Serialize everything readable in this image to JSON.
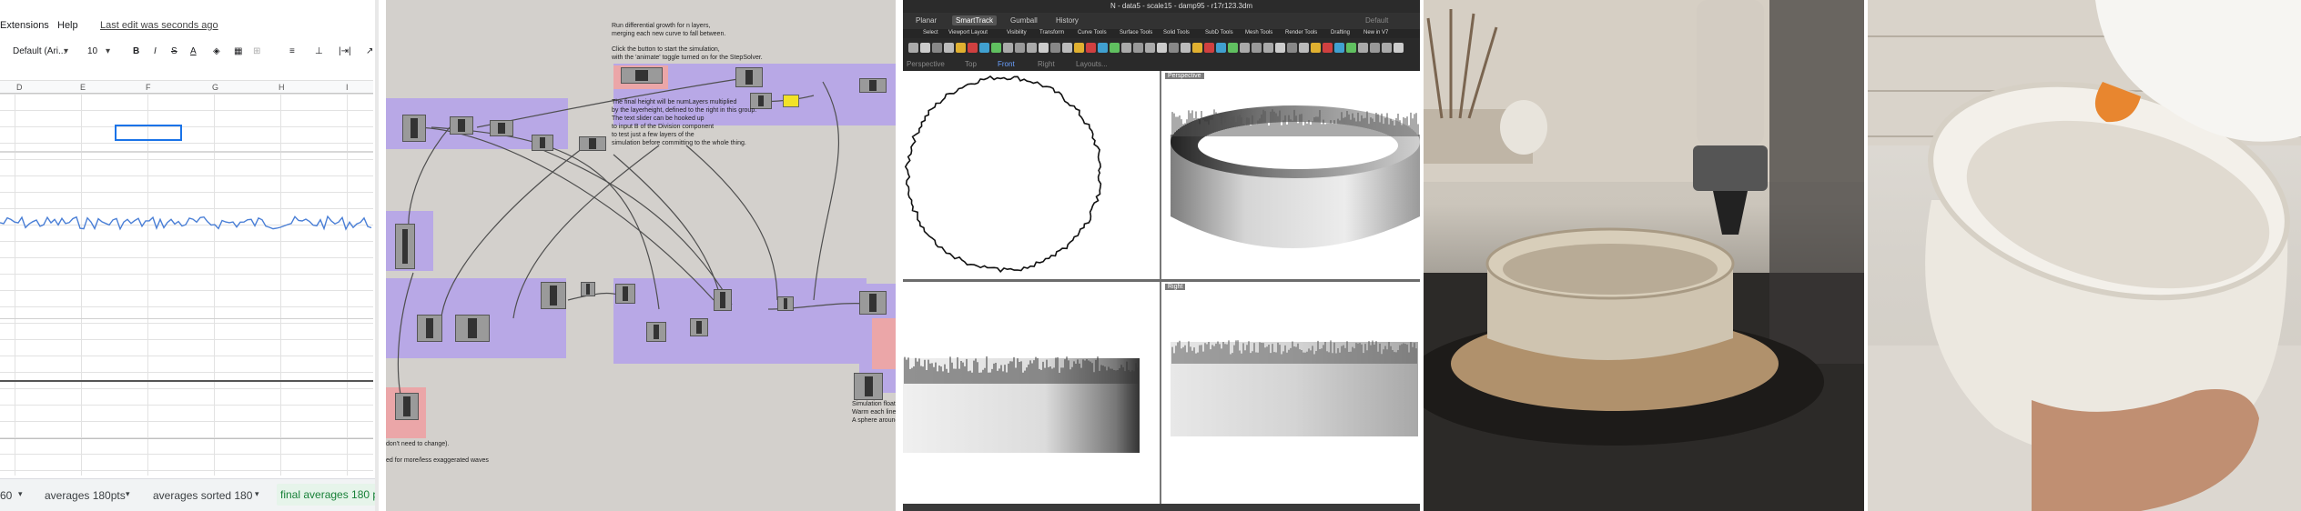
{
  "sheets": {
    "menu": {
      "extensions": "Extensions",
      "help": "Help",
      "last_edit": "Last edit was seconds ago"
    },
    "toolbar": {
      "font": "Default (Ari...",
      "size": "10",
      "bold": "B",
      "italic": "I",
      "strike": "S",
      "text_color": "A"
    },
    "columns": [
      "D",
      "E",
      "F",
      "G",
      "H",
      "I"
    ],
    "tabs": [
      "60",
      "averages 180pts",
      "averages sorted 180",
      "final averages 180 p"
    ],
    "active_tab_index": 3,
    "colors": {
      "selection": "#1a73e8",
      "series": "#4a7fd6",
      "active_tab": "#188038"
    }
  },
  "grasshopper": {
    "notes": {
      "note1": "Run differential growth for n layers,\nmerging each new curve to fall between.",
      "note2": "Click the button to start the simulation,\nwith the 'animate' toggle turned on for the StepSolver.",
      "note3": "The final height will be numLayers multiplied\nby the layerheight, defined to the right in this group.\nThe text slider can be hooked up\nto input B of the Division component\nto test just a few layers of the\nsimulation before committing to the whole thing.",
      "note4": "Simulation floats...\nWarm each line se...\nA sphere around e...",
      "note5": "don't need to change).",
      "note6": "ed for more/less exaggerated waves"
    },
    "colors": {
      "canvas": "#d3d0cc",
      "group_purple": "#b8a8e6",
      "group_pink": "#eba6a8",
      "toggle_yellow": "#f2e227"
    }
  },
  "rhino": {
    "title": "N - data5 - scale15 - damp95 - r17r123.3dm",
    "tabs": [
      "Planar",
      "SmartTrack",
      "Gumball",
      "History"
    ],
    "active_tab": "SmartTrack",
    "layer": "Default",
    "toolbar_tabs": [
      "Select",
      "Viewport Layout",
      "Visibility",
      "Transform",
      "Curve Tools",
      "Surface Tools",
      "Solid Tools",
      "SubD Tools",
      "Mesh Tools",
      "Render Tools",
      "Drafting",
      "New in V7"
    ],
    "view_tabs": [
      "Perspective",
      "Top",
      "Front",
      "Right",
      "Layouts..."
    ],
    "active_view_tab": "Front",
    "viewports": {
      "perspective": "Perspective",
      "right": "Right"
    }
  },
  "photos": {
    "printer": "clay 3D printer nozzle printing ruffled vessel",
    "bowl": "hand-held ceramic bowl with ruffled rim"
  }
}
